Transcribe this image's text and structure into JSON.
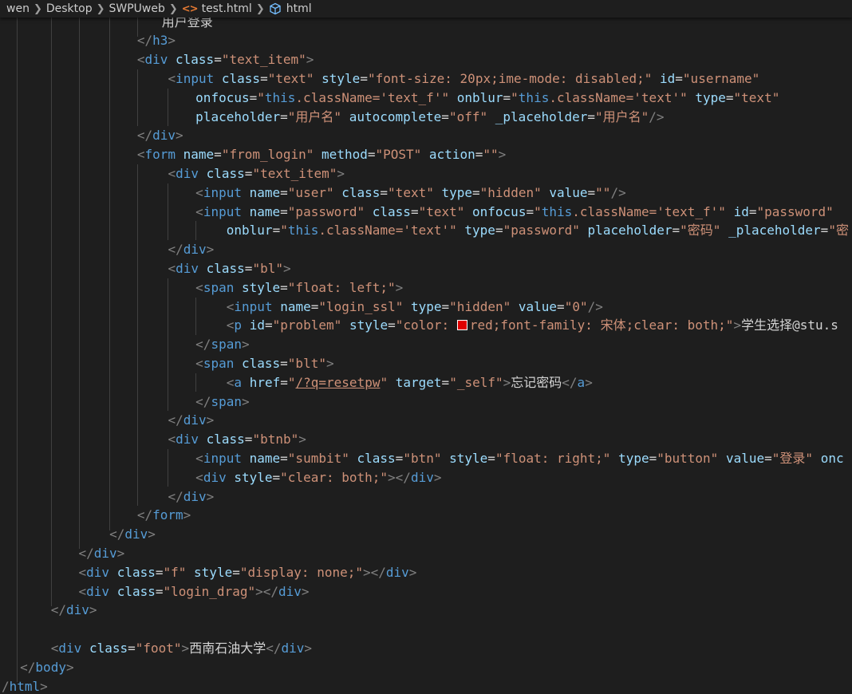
{
  "breadcrumb": {
    "items": [
      "wen",
      "Desktop",
      "SWPUweb",
      "test.html",
      "html"
    ],
    "file_icon": "html-file-icon",
    "symbol_icon": "html-element-cube-icon"
  },
  "theme": {
    "background": "#1e1e1e",
    "tag": "#569cd6",
    "bracket": "#808080",
    "attr": "#9cdcfe",
    "string": "#ce9178",
    "text": "#d4d4d4",
    "swatch": "#e00000"
  },
  "code_lines": [
    {
      "indent": 52,
      "tokens": [
        [
          "t",
          "用户登录"
        ]
      ]
    },
    {
      "indent": 44,
      "tokens": [
        [
          "b",
          "</"
        ],
        [
          "g",
          "h3"
        ],
        [
          "b",
          ">"
        ]
      ]
    },
    {
      "indent": 44,
      "tokens": [
        [
          "b",
          "<"
        ],
        [
          "g",
          "div"
        ],
        [
          "t",
          " "
        ],
        [
          "a",
          "class"
        ],
        [
          "e",
          "="
        ],
        [
          "s",
          "\"text_item\""
        ],
        [
          "b",
          ">"
        ]
      ]
    },
    {
      "indent": 54,
      "tokens": [
        [
          "b",
          "<"
        ],
        [
          "g",
          "input"
        ],
        [
          "t",
          " "
        ],
        [
          "a",
          "class"
        ],
        [
          "e",
          "="
        ],
        [
          "s",
          "\"text\""
        ],
        [
          "t",
          " "
        ],
        [
          "a",
          "style"
        ],
        [
          "e",
          "="
        ],
        [
          "s",
          "\"font-size: 20px;ime-mode: disabled;\""
        ],
        [
          "t",
          " "
        ],
        [
          "a",
          "id"
        ],
        [
          "e",
          "="
        ],
        [
          "s",
          "\"username\""
        ]
      ]
    },
    {
      "indent": 63,
      "tokens": [
        [
          "a",
          "onfocus"
        ],
        [
          "e",
          "="
        ],
        [
          "s",
          "\""
        ],
        [
          "k",
          "this"
        ],
        [
          "s",
          ".className='text_f'\""
        ],
        [
          "t",
          " "
        ],
        [
          "a",
          "onblur"
        ],
        [
          "e",
          "="
        ],
        [
          "s",
          "\""
        ],
        [
          "k",
          "this"
        ],
        [
          "s",
          ".className='text'\""
        ],
        [
          "t",
          " "
        ],
        [
          "a",
          "type"
        ],
        [
          "e",
          "="
        ],
        [
          "s",
          "\"text\""
        ]
      ]
    },
    {
      "indent": 63,
      "tokens": [
        [
          "a",
          "placeholder"
        ],
        [
          "e",
          "="
        ],
        [
          "s",
          "\"用户名\""
        ],
        [
          "t",
          " "
        ],
        [
          "a",
          "autocomplete"
        ],
        [
          "e",
          "="
        ],
        [
          "s",
          "\"off\""
        ],
        [
          "t",
          " "
        ],
        [
          "a",
          "_placeholder"
        ],
        [
          "e",
          "="
        ],
        [
          "s",
          "\"用户名\""
        ],
        [
          "b",
          "/>"
        ]
      ]
    },
    {
      "indent": 44,
      "tokens": [
        [
          "b",
          "</"
        ],
        [
          "g",
          "div"
        ],
        [
          "b",
          ">"
        ]
      ]
    },
    {
      "indent": 44,
      "tokens": [
        [
          "b",
          "<"
        ],
        [
          "g",
          "form"
        ],
        [
          "t",
          " "
        ],
        [
          "a",
          "name"
        ],
        [
          "e",
          "="
        ],
        [
          "s",
          "\"from_login\""
        ],
        [
          "t",
          " "
        ],
        [
          "a",
          "method"
        ],
        [
          "e",
          "="
        ],
        [
          "s",
          "\"POST\""
        ],
        [
          "t",
          " "
        ],
        [
          "a",
          "action"
        ],
        [
          "e",
          "="
        ],
        [
          "s",
          "\"\""
        ],
        [
          "b",
          ">"
        ]
      ]
    },
    {
      "indent": 54,
      "tokens": [
        [
          "b",
          "<"
        ],
        [
          "g",
          "div"
        ],
        [
          "t",
          " "
        ],
        [
          "a",
          "class"
        ],
        [
          "e",
          "="
        ],
        [
          "s",
          "\"text_item\""
        ],
        [
          "b",
          ">"
        ]
      ]
    },
    {
      "indent": 63,
      "tokens": [
        [
          "b",
          "<"
        ],
        [
          "g",
          "input"
        ],
        [
          "t",
          " "
        ],
        [
          "a",
          "name"
        ],
        [
          "e",
          "="
        ],
        [
          "s",
          "\"user\""
        ],
        [
          "t",
          " "
        ],
        [
          "a",
          "class"
        ],
        [
          "e",
          "="
        ],
        [
          "s",
          "\"text\""
        ],
        [
          "t",
          " "
        ],
        [
          "a",
          "type"
        ],
        [
          "e",
          "="
        ],
        [
          "s",
          "\"hidden\""
        ],
        [
          "t",
          " "
        ],
        [
          "a",
          "value"
        ],
        [
          "e",
          "="
        ],
        [
          "s",
          "\"\""
        ],
        [
          "b",
          "/>"
        ]
      ]
    },
    {
      "indent": 63,
      "tokens": [
        [
          "b",
          "<"
        ],
        [
          "g",
          "input"
        ],
        [
          "t",
          " "
        ],
        [
          "a",
          "name"
        ],
        [
          "e",
          "="
        ],
        [
          "s",
          "\"password\""
        ],
        [
          "t",
          " "
        ],
        [
          "a",
          "class"
        ],
        [
          "e",
          "="
        ],
        [
          "s",
          "\"text\""
        ],
        [
          "t",
          " "
        ],
        [
          "a",
          "onfocus"
        ],
        [
          "e",
          "="
        ],
        [
          "s",
          "\""
        ],
        [
          "k",
          "this"
        ],
        [
          "s",
          ".className='text_f'\""
        ],
        [
          "t",
          " "
        ],
        [
          "a",
          "id"
        ],
        [
          "e",
          "="
        ],
        [
          "s",
          "\"password\""
        ]
      ]
    },
    {
      "indent": 73,
      "tokens": [
        [
          "a",
          "onblur"
        ],
        [
          "e",
          "="
        ],
        [
          "s",
          "\""
        ],
        [
          "k",
          "this"
        ],
        [
          "s",
          ".className='text'\""
        ],
        [
          "t",
          " "
        ],
        [
          "a",
          "type"
        ],
        [
          "e",
          "="
        ],
        [
          "s",
          "\"password\""
        ],
        [
          "t",
          " "
        ],
        [
          "a",
          "placeholder"
        ],
        [
          "e",
          "="
        ],
        [
          "s",
          "\"密码\""
        ],
        [
          "t",
          " "
        ],
        [
          "a",
          "_placeholder"
        ],
        [
          "e",
          "="
        ],
        [
          "s",
          "\"密"
        ]
      ]
    },
    {
      "indent": 54,
      "tokens": [
        [
          "b",
          "</"
        ],
        [
          "g",
          "div"
        ],
        [
          "b",
          ">"
        ]
      ]
    },
    {
      "indent": 54,
      "tokens": [
        [
          "b",
          "<"
        ],
        [
          "g",
          "div"
        ],
        [
          "t",
          " "
        ],
        [
          "a",
          "class"
        ],
        [
          "e",
          "="
        ],
        [
          "s",
          "\"bl\""
        ],
        [
          "b",
          ">"
        ]
      ]
    },
    {
      "indent": 63,
      "tokens": [
        [
          "b",
          "<"
        ],
        [
          "g",
          "span"
        ],
        [
          "t",
          " "
        ],
        [
          "a",
          "style"
        ],
        [
          "e",
          "="
        ],
        [
          "s",
          "\"float: left;\""
        ],
        [
          "b",
          ">"
        ]
      ]
    },
    {
      "indent": 73,
      "tokens": [
        [
          "b",
          "<"
        ],
        [
          "g",
          "input"
        ],
        [
          "t",
          " "
        ],
        [
          "a",
          "name"
        ],
        [
          "e",
          "="
        ],
        [
          "s",
          "\"login_ssl\""
        ],
        [
          "t",
          " "
        ],
        [
          "a",
          "type"
        ],
        [
          "e",
          "="
        ],
        [
          "s",
          "\"hidden\""
        ],
        [
          "t",
          " "
        ],
        [
          "a",
          "value"
        ],
        [
          "e",
          "="
        ],
        [
          "s",
          "\"0\""
        ],
        [
          "b",
          "/>"
        ]
      ]
    },
    {
      "indent": 73,
      "tokens": [
        [
          "b",
          "<"
        ],
        [
          "g",
          "p"
        ],
        [
          "t",
          " "
        ],
        [
          "a",
          "id"
        ],
        [
          "e",
          "="
        ],
        [
          "s",
          "\"problem\""
        ],
        [
          "t",
          " "
        ],
        [
          "a",
          "style"
        ],
        [
          "e",
          "="
        ],
        [
          "s",
          "\"color: "
        ],
        [
          "w",
          ""
        ],
        [
          "s",
          "red;font-family: 宋体;clear: both;\""
        ],
        [
          "b",
          ">"
        ],
        [
          "t",
          "学生选择@stu.s"
        ]
      ]
    },
    {
      "indent": 63,
      "tokens": [
        [
          "b",
          "</"
        ],
        [
          "g",
          "span"
        ],
        [
          "b",
          ">"
        ]
      ]
    },
    {
      "indent": 63,
      "tokens": [
        [
          "b",
          "<"
        ],
        [
          "g",
          "span"
        ],
        [
          "t",
          " "
        ],
        [
          "a",
          "class"
        ],
        [
          "e",
          "="
        ],
        [
          "s",
          "\"blt\""
        ],
        [
          "b",
          ">"
        ]
      ]
    },
    {
      "indent": 73,
      "tokens": [
        [
          "b",
          "<"
        ],
        [
          "g",
          "a"
        ],
        [
          "t",
          " "
        ],
        [
          "a",
          "href"
        ],
        [
          "e",
          "="
        ],
        [
          "s",
          "\""
        ],
        [
          "l",
          "/?q=resetpw"
        ],
        [
          "s",
          "\""
        ],
        [
          "t",
          " "
        ],
        [
          "a",
          "target"
        ],
        [
          "e",
          "="
        ],
        [
          "s",
          "\"_self\""
        ],
        [
          "b",
          ">"
        ],
        [
          "t",
          "忘记密码"
        ],
        [
          "b",
          "</"
        ],
        [
          "g",
          "a"
        ],
        [
          "b",
          ">"
        ]
      ]
    },
    {
      "indent": 63,
      "tokens": [
        [
          "b",
          "</"
        ],
        [
          "g",
          "span"
        ],
        [
          "b",
          ">"
        ]
      ]
    },
    {
      "indent": 54,
      "tokens": [
        [
          "b",
          "</"
        ],
        [
          "g",
          "div"
        ],
        [
          "b",
          ">"
        ]
      ]
    },
    {
      "indent": 54,
      "tokens": [
        [
          "b",
          "<"
        ],
        [
          "g",
          "div"
        ],
        [
          "t",
          " "
        ],
        [
          "a",
          "class"
        ],
        [
          "e",
          "="
        ],
        [
          "s",
          "\"btnb\""
        ],
        [
          "b",
          ">"
        ]
      ]
    },
    {
      "indent": 63,
      "tokens": [
        [
          "b",
          "<"
        ],
        [
          "g",
          "input"
        ],
        [
          "t",
          " "
        ],
        [
          "a",
          "name"
        ],
        [
          "e",
          "="
        ],
        [
          "s",
          "\"sumbit\""
        ],
        [
          "t",
          " "
        ],
        [
          "a",
          "class"
        ],
        [
          "e",
          "="
        ],
        [
          "s",
          "\"btn\""
        ],
        [
          "t",
          " "
        ],
        [
          "a",
          "style"
        ],
        [
          "e",
          "="
        ],
        [
          "s",
          "\"float: right;\""
        ],
        [
          "t",
          " "
        ],
        [
          "a",
          "type"
        ],
        [
          "e",
          "="
        ],
        [
          "s",
          "\"button\""
        ],
        [
          "t",
          " "
        ],
        [
          "a",
          "value"
        ],
        [
          "e",
          "="
        ],
        [
          "s",
          "\"登录\""
        ],
        [
          "t",
          " "
        ],
        [
          "a",
          "onc"
        ]
      ]
    },
    {
      "indent": 63,
      "tokens": [
        [
          "b",
          "<"
        ],
        [
          "g",
          "div"
        ],
        [
          "t",
          " "
        ],
        [
          "a",
          "style"
        ],
        [
          "e",
          "="
        ],
        [
          "s",
          "\"clear: both;\""
        ],
        [
          "b",
          "></"
        ],
        [
          "g",
          "div"
        ],
        [
          "b",
          ">"
        ]
      ]
    },
    {
      "indent": 54,
      "tokens": [
        [
          "b",
          "</"
        ],
        [
          "g",
          "div"
        ],
        [
          "b",
          ">"
        ]
      ]
    },
    {
      "indent": 44,
      "tokens": [
        [
          "b",
          "</"
        ],
        [
          "g",
          "form"
        ],
        [
          "b",
          ">"
        ]
      ]
    },
    {
      "indent": 35,
      "tokens": [
        [
          "b",
          "</"
        ],
        [
          "g",
          "div"
        ],
        [
          "b",
          ">"
        ]
      ]
    },
    {
      "indent": 25,
      "tokens": [
        [
          "b",
          "</"
        ],
        [
          "g",
          "div"
        ],
        [
          "b",
          ">"
        ]
      ]
    },
    {
      "indent": 25,
      "tokens": [
        [
          "b",
          "<"
        ],
        [
          "g",
          "div"
        ],
        [
          "t",
          " "
        ],
        [
          "a",
          "class"
        ],
        [
          "e",
          "="
        ],
        [
          "s",
          "\"f\""
        ],
        [
          "t",
          " "
        ],
        [
          "a",
          "style"
        ],
        [
          "e",
          "="
        ],
        [
          "s",
          "\"display: none;\""
        ],
        [
          "b",
          "></"
        ],
        [
          "g",
          "div"
        ],
        [
          "b",
          ">"
        ]
      ]
    },
    {
      "indent": 25,
      "tokens": [
        [
          "b",
          "<"
        ],
        [
          "g",
          "div"
        ],
        [
          "t",
          " "
        ],
        [
          "a",
          "class"
        ],
        [
          "e",
          "="
        ],
        [
          "s",
          "\"login_drag\""
        ],
        [
          "b",
          "></"
        ],
        [
          "g",
          "div"
        ],
        [
          "b",
          ">"
        ]
      ]
    },
    {
      "indent": 16,
      "tokens": [
        [
          "b",
          "</"
        ],
        [
          "g",
          "div"
        ],
        [
          "b",
          ">"
        ]
      ]
    },
    {
      "indent": 0,
      "tokens": []
    },
    {
      "indent": 16,
      "tokens": [
        [
          "b",
          "<"
        ],
        [
          "g",
          "div"
        ],
        [
          "t",
          " "
        ],
        [
          "a",
          "class"
        ],
        [
          "e",
          "="
        ],
        [
          "s",
          "\"foot\""
        ],
        [
          "b",
          ">"
        ],
        [
          "t",
          "西南石油大学"
        ],
        [
          "b",
          "</"
        ],
        [
          "g",
          "div"
        ],
        [
          "b",
          ">"
        ]
      ]
    },
    {
      "indent": 6,
      "tokens": [
        [
          "b",
          "</"
        ],
        [
          "g",
          "body"
        ],
        [
          "b",
          ">"
        ]
      ]
    },
    {
      "indent": 0,
      "tokens": [
        [
          "b",
          "/"
        ],
        [
          "g",
          "html"
        ],
        [
          "b",
          ">"
        ]
      ]
    }
  ]
}
